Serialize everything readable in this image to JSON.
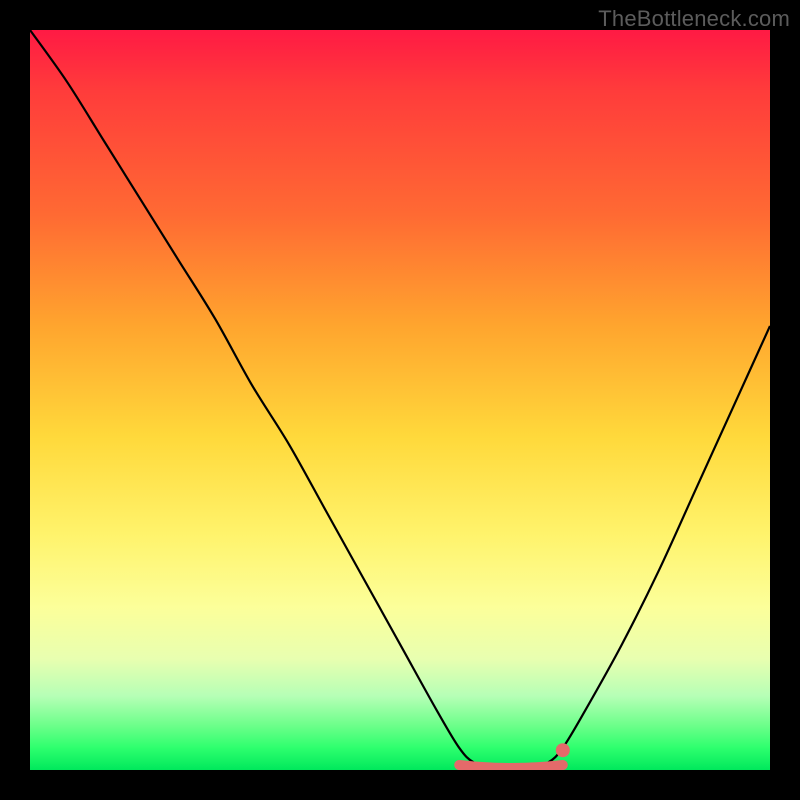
{
  "watermark": "TheBottleneck.com",
  "colors": {
    "frame": "#000000",
    "curve": "#000000",
    "marker": "#e46a6a",
    "gradient_top": "#ff1a44",
    "gradient_bottom": "#00e85c"
  },
  "chart_data": {
    "type": "line",
    "title": "",
    "xlabel": "",
    "ylabel": "",
    "xlim": [
      0,
      100
    ],
    "ylim": [
      0,
      100
    ],
    "x": [
      0,
      5,
      10,
      15,
      20,
      25,
      30,
      35,
      40,
      45,
      50,
      55,
      58,
      60,
      63,
      65,
      67,
      70,
      72,
      75,
      80,
      85,
      90,
      95,
      100
    ],
    "y": [
      100,
      93,
      85,
      77,
      69,
      61,
      52,
      44,
      35,
      26,
      17,
      8,
      3,
      1,
      0,
      0,
      0,
      1,
      3,
      8,
      17,
      27,
      38,
      49,
      60
    ],
    "annotations": [
      {
        "type": "flat_region",
        "x_start": 58,
        "x_end": 72,
        "y": 0,
        "color": "#e46a6a"
      },
      {
        "type": "point",
        "x": 72,
        "y": 2,
        "color": "#e46a6a"
      }
    ]
  }
}
